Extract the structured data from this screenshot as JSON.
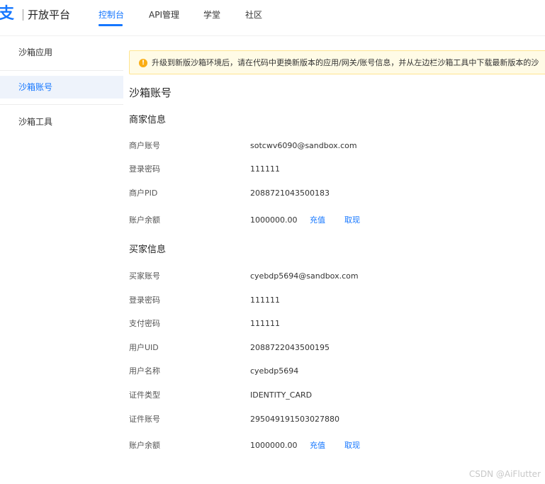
{
  "header": {
    "logo_icon": "支",
    "logo_text": "开放平台",
    "tabs": [
      "控制台",
      "API管理",
      "学堂",
      "社区"
    ],
    "active_tab": "控制台"
  },
  "sidebar": {
    "items": [
      {
        "label": "沙箱应用",
        "active": false
      },
      {
        "label": "沙箱账号",
        "active": true
      },
      {
        "label": "沙箱工具",
        "active": false
      }
    ]
  },
  "alert": {
    "icon": "warning-icon",
    "text": "升级到新版沙箱环境后，请在代码中更换新版本的应用/网关/账号信息，并从左边栏沙箱工具中下载最新版本的沙"
  },
  "page_title": "沙箱账号",
  "merchant": {
    "title": "商家信息",
    "rows": [
      {
        "label": "商户账号",
        "value": "sotcwv6090@sandbox.com"
      },
      {
        "label": "登录密码",
        "value": "111111"
      },
      {
        "label": "商户PID",
        "value": "2088721043500183"
      },
      {
        "label": "账户余额",
        "value": "1000000.00"
      }
    ],
    "recharge": "充值",
    "withdraw": "取现"
  },
  "buyer": {
    "title": "买家信息",
    "rows": [
      {
        "label": "买家账号",
        "value": "cyebdp5694@sandbox.com"
      },
      {
        "label": "登录密码",
        "value": "111111"
      },
      {
        "label": "支付密码",
        "value": "111111"
      },
      {
        "label": "用户UID",
        "value": "2088722043500195"
      },
      {
        "label": "用户名称",
        "value": "cyebdp5694"
      },
      {
        "label": "证件类型",
        "value": "IDENTITY_CARD"
      },
      {
        "label": "证件账号",
        "value": "295049191503027880"
      },
      {
        "label": "账户余额",
        "value": "1000000.00"
      }
    ],
    "recharge": "充值",
    "withdraw": "取现"
  },
  "watermark": "CSDN @AiFlutter",
  "colors": {
    "accent": "#1677ff",
    "alert_bg": "#fffbe6",
    "alert_icon": "#faad14",
    "sidebar_active_bg": "#eef3fb"
  }
}
